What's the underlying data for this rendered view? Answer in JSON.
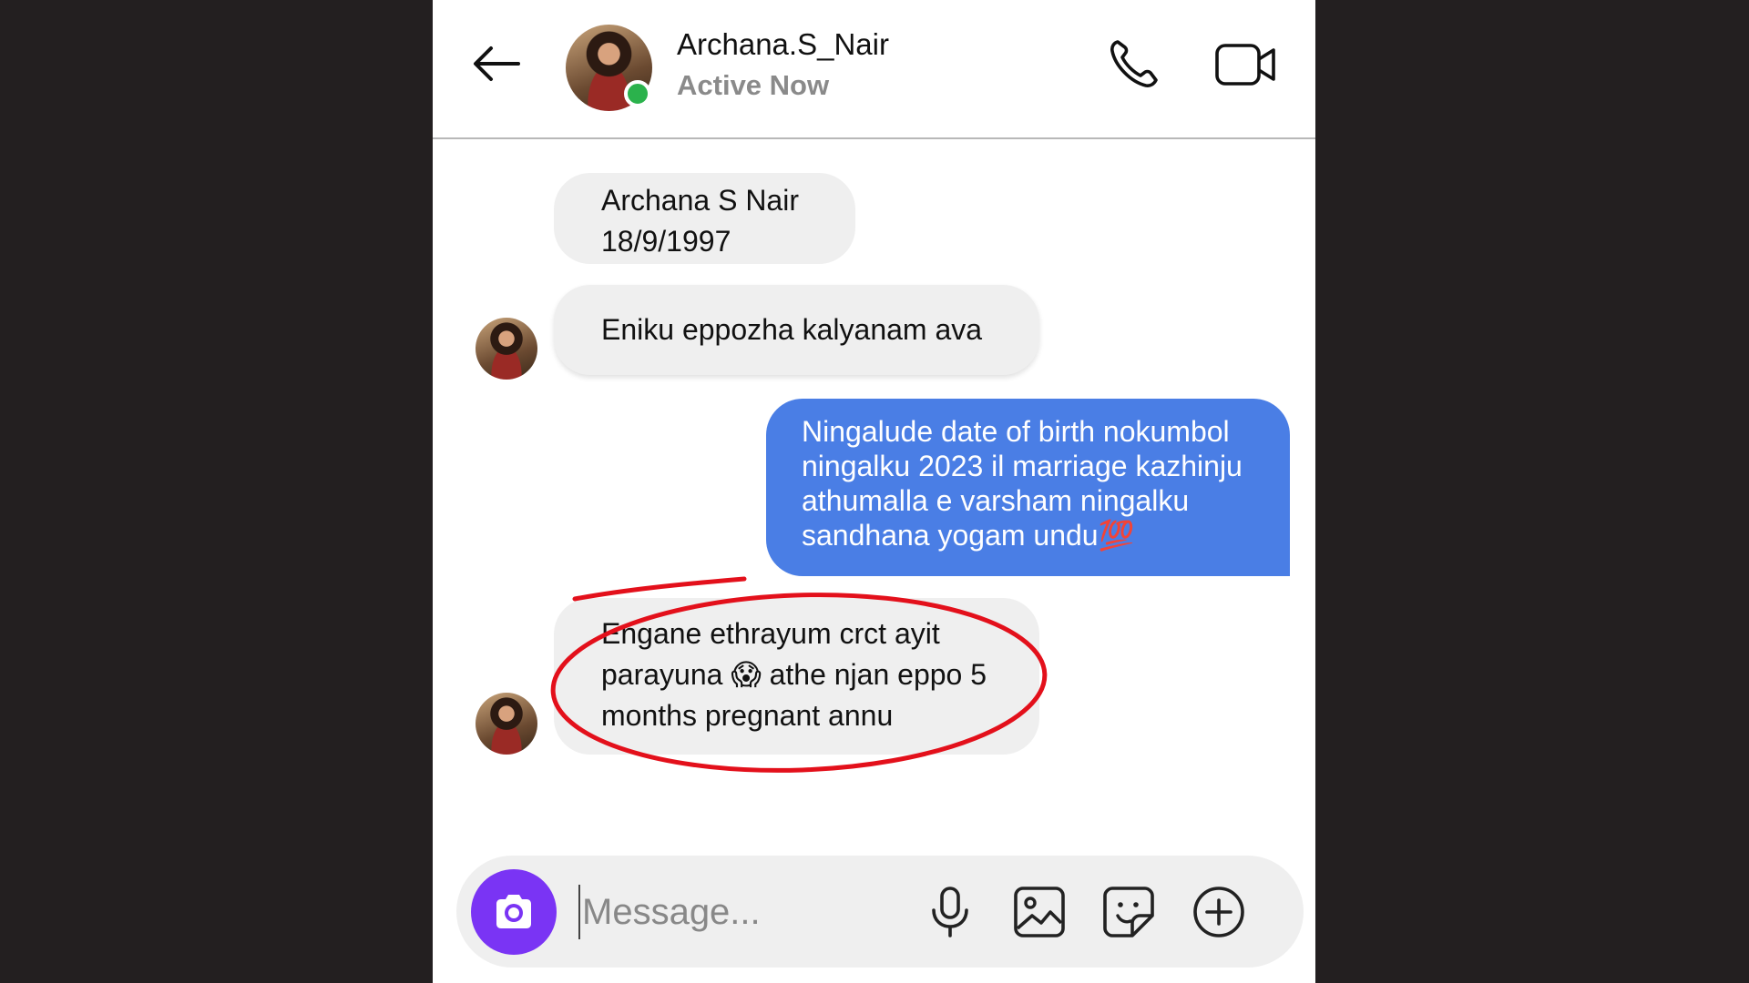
{
  "header": {
    "contact_name": "Archana.S_Nair",
    "status": "Active Now",
    "back_icon": "arrow-left-icon",
    "call_icon": "phone-icon",
    "video_icon": "video-camera-icon"
  },
  "messages": [
    {
      "sender": "contact",
      "lines": [
        "Archana S Nair",
        "18/9/1997"
      ]
    },
    {
      "sender": "contact",
      "lines": [
        "Eniku eppozha kalyanam ava"
      ]
    },
    {
      "sender": "me",
      "lines": [
        "Ningalude date of birth nokumbol",
        "ningalku 2023 il marriage kazhinju",
        "athumalla e varsham ningalku",
        "sandhana yogam undu💯"
      ]
    },
    {
      "sender": "contact",
      "lines": [
        "Engane ethrayum crct ayit",
        "parayuna 😱 athe njan eppo 5",
        "months pregnant annu"
      ]
    }
  ],
  "composer": {
    "placeholder": "Message...",
    "icons": [
      "camera-icon",
      "microphone-icon",
      "gallery-icon",
      "sticker-icon",
      "plus-icon"
    ]
  },
  "colors": {
    "outgoing_bubble": "#4a7ee5",
    "incoming_bubble": "#efefef",
    "camera_button": "#7a34f4",
    "online_dot": "#2bb24c",
    "annotation": "#e3101b"
  }
}
